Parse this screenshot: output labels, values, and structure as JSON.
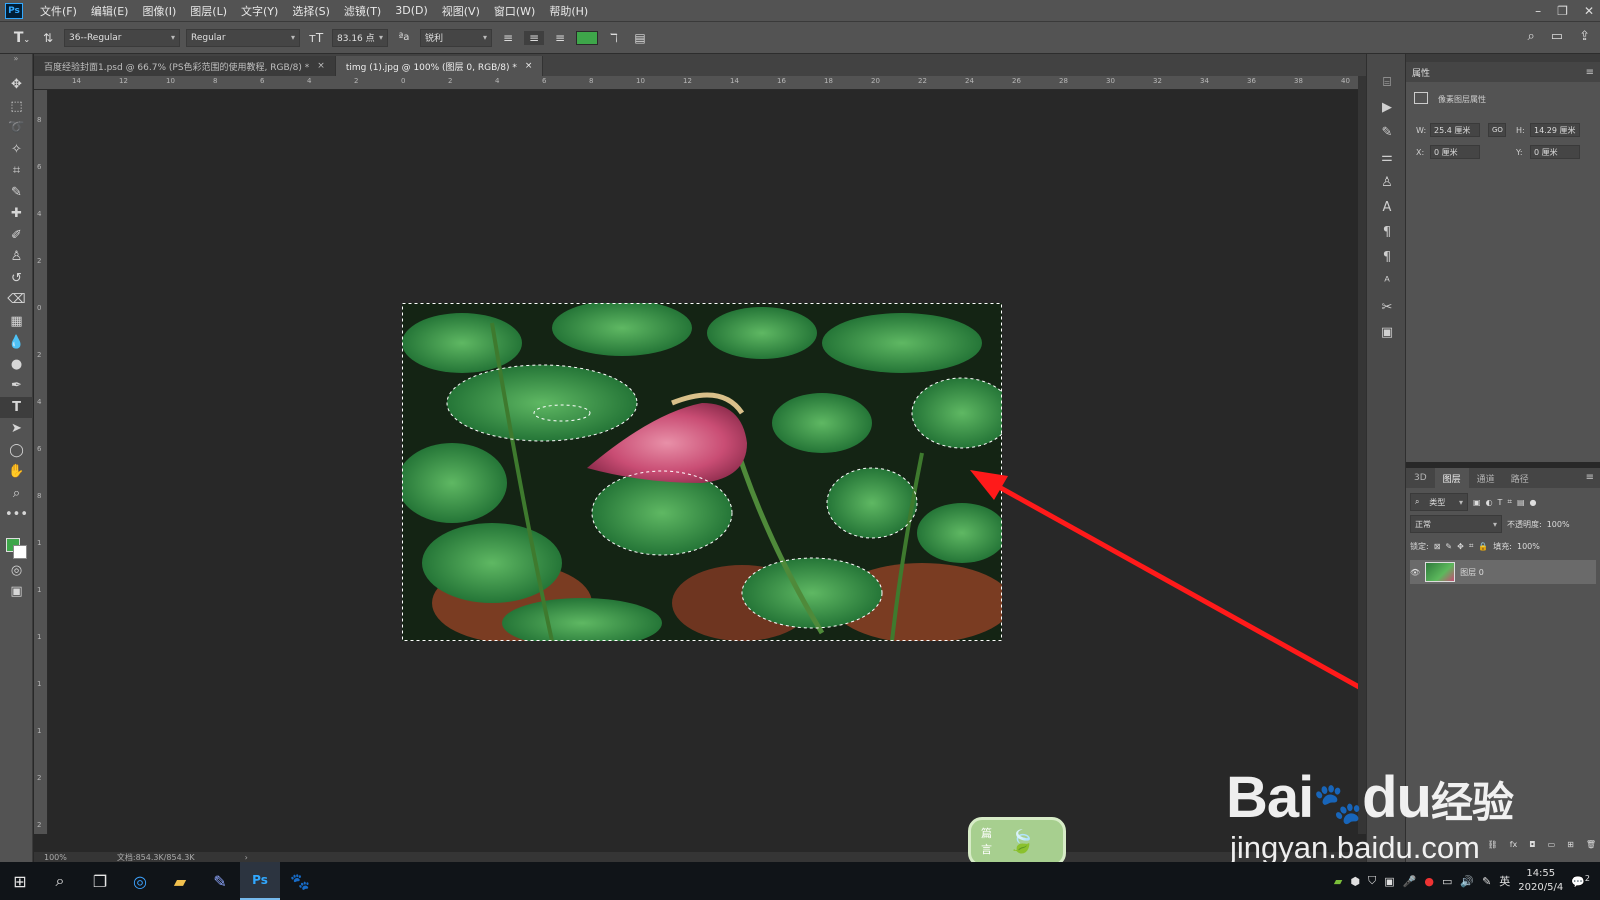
{
  "app": {
    "logo": "Ps"
  },
  "menu": [
    "文件(F)",
    "编辑(E)",
    "图像(I)",
    "图层(L)",
    "文字(Y)",
    "选择(S)",
    "滤镜(T)",
    "3D(D)",
    "视图(V)",
    "窗口(W)",
    "帮助(H)"
  ],
  "options": {
    "font_family": "36--Regular",
    "font_style": "Regular",
    "font_size": "83.16 点",
    "antialias": "锐利",
    "text_color": "#3ea64a"
  },
  "tabs": [
    {
      "label": "百度经验封面1.psd @ 66.7% (PS色彩范围的使用教程, RGB/8) *",
      "close": "×"
    },
    {
      "label": "timg (1).jpg @ 100% (图层 0, RGB/8) *",
      "close": "×"
    }
  ],
  "ruler_top": [
    "14",
    "12",
    "10",
    "8",
    "6",
    "4",
    "2",
    "0",
    "2",
    "4",
    "6",
    "8",
    "10",
    "12",
    "14",
    "16",
    "18",
    "20",
    "22",
    "24",
    "26",
    "28",
    "30",
    "32",
    "34",
    "36",
    "38",
    "40"
  ],
  "ruler_left": [
    "8",
    "6",
    "4",
    "2",
    "0",
    "2",
    "4",
    "6",
    "8",
    "1",
    "1",
    "1",
    "1",
    "1",
    "2",
    "2"
  ],
  "status": {
    "zoom": "100%",
    "doc": "文档:854.3K/854.3K",
    "arrow": "›"
  },
  "properties": {
    "title": "属性",
    "section": "像素图层属性",
    "w_label": "W:",
    "w": "25.4 厘米",
    "link": "GO",
    "h_label": "H:",
    "h": "14.29 厘米",
    "x_label": "X:",
    "x": "0 厘米",
    "y_label": "Y:",
    "y": "0 厘米"
  },
  "layers": {
    "tabs": [
      "3D",
      "图层",
      "通道",
      "路径"
    ],
    "filter": "类型",
    "blend_mode": "正常",
    "opacity_label": "不透明度:",
    "opacity": "100%",
    "lock_label": "锁定:",
    "fill_label": "填充:",
    "fill": "100%",
    "layer_name": "图层 0"
  },
  "watermark": {
    "brand": "Bai",
    "brand2": "du",
    "cn": "经验",
    "url": "jingyan.baidu.com"
  },
  "badge": {
    "line1": "篇",
    "line2": "言"
  },
  "taskbar": {
    "time": "14:55",
    "date": "2020/5/4",
    "ime": "英",
    "notif": "2"
  }
}
